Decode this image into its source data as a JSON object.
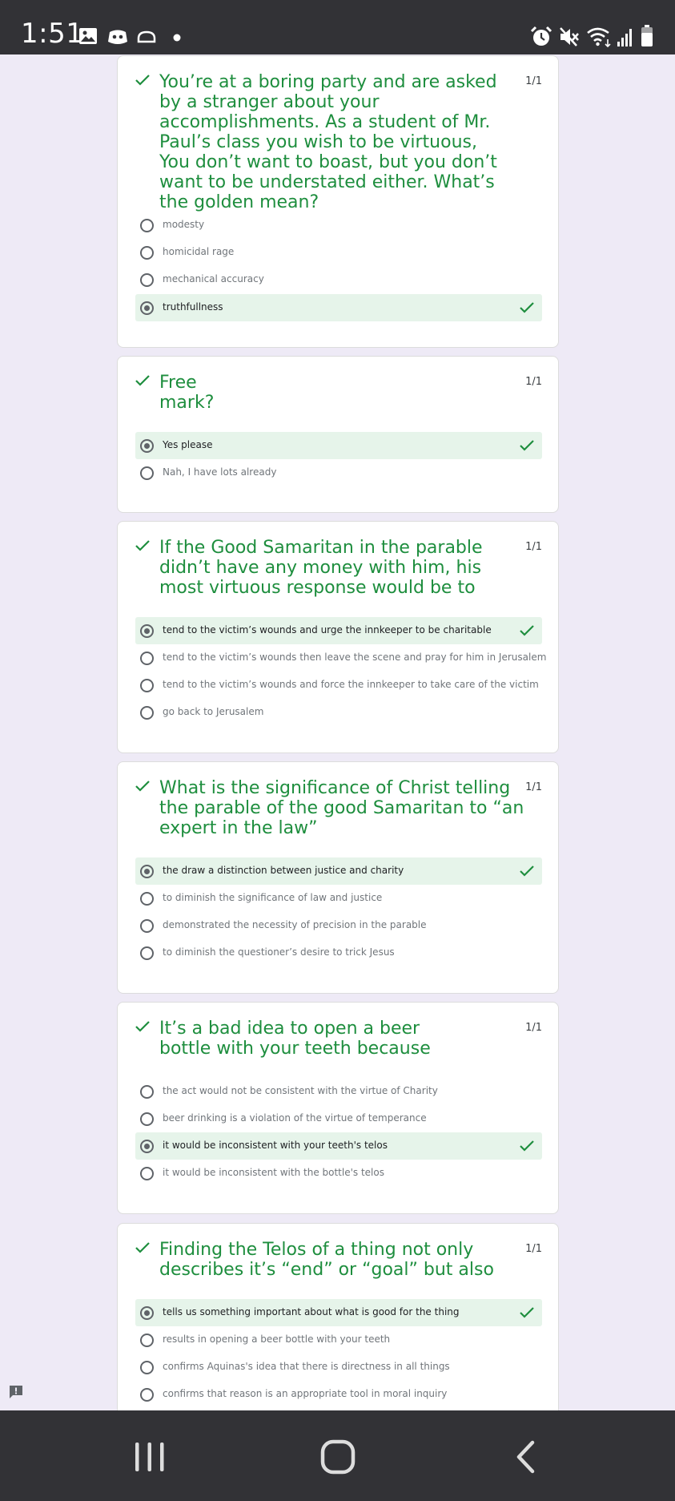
{
  "status_bar": {
    "time": "1:51"
  },
  "questions": [
    {
      "title": "You’re at a boring party and are asked by a stranger about your accomplishments. As a student of Mr. Paul’s class you wish to be virtuous, You don’t want to boast, but you don’t want to be understated either. What’s the golden mean?",
      "score": "1/1",
      "options": [
        "modesty",
        "homicidal rage",
        "mechanical accuracy",
        "truthfullness"
      ],
      "selected_index": 3
    },
    {
      "title": "Free mark?",
      "score": "1/1",
      "options": [
        "Yes please",
        "Nah, I have lots already"
      ],
      "selected_index": 0
    },
    {
      "title": "If the Good Samaritan in the parable didn’t have any money with him, his most virtuous response would be to",
      "score": "1/1",
      "options": [
        "tend to the victim’s wounds and urge the innkeeper to be charitable",
        "tend to the victim’s wounds then leave the scene and pray for him in Jerusalem",
        "tend to the victim’s wounds and force the innkeeper to take care of the victim",
        "go back to Jerusalem"
      ],
      "selected_index": 0
    },
    {
      "title": "What is the significance of Christ telling the parable of the good Samaritan to “an expert in the law”",
      "score": "1/1",
      "options": [
        "the draw a distinction between justice and charity",
        "to diminish the significance of law and justice",
        "demonstrated the necessity of precision in the parable",
        "to diminish the questioner’s desire to trick Jesus"
      ],
      "selected_index": 0
    },
    {
      "title": "It’s a bad idea to open a beer bottle with your teeth because",
      "score": "1/1",
      "options": [
        "the act would not be consistent with the virtue of Charity",
        "beer drinking is a violation of the virtue of temperance",
        "it would be inconsistent with your teeth's telos",
        "it would be inconsistent with the bottle's telos"
      ],
      "selected_index": 2
    },
    {
      "title": "Finding the Telos of a thing not only describes it’s “end” or “goal” but also",
      "score": "1/1",
      "options": [
        "tells us something important about what is good for the thing",
        "results in opening a beer bottle with your teeth",
        "confirms Aquinas's idea that there is directness in all things",
        "confirms that reason is an appropriate tool in moral inquiry"
      ],
      "selected_index": 0
    }
  ],
  "icons": {
    "status_left": [
      "gallery-icon",
      "discord-icon",
      "cloud-icon",
      "notification-dot-icon"
    ],
    "status_right": [
      "alarm-icon",
      "mute-icon",
      "wifi-icon",
      "signal-icon",
      "battery-icon"
    ],
    "question_correct": "check-icon",
    "feedback": "feedback-icon",
    "nav": [
      "recents-icon",
      "home-icon",
      "back-icon"
    ]
  },
  "colors": {
    "correct_green": "#1e8e3e",
    "correct_background": "#e6f4ea",
    "page_background": "#eeeaf6",
    "system_bar": "#323236"
  }
}
